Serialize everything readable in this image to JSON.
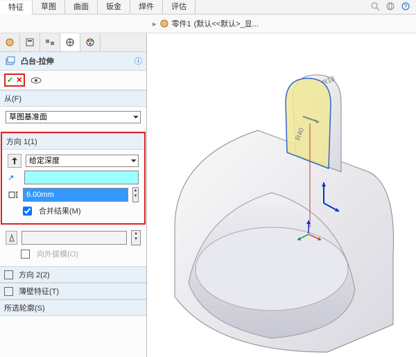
{
  "tabs": [
    "特征",
    "草图",
    "曲面",
    "钣金",
    "焊件",
    "评估"
  ],
  "breadcrumb": {
    "part": "零件1",
    "trail": "(默认<<默认>_显..."
  },
  "feature": {
    "title": "凸台-拉伸"
  },
  "from": {
    "header": "从(F)",
    "value": "草图基准面"
  },
  "dir1": {
    "header": "方向 1(1)",
    "method": "给定深度",
    "distance": "6.00mm",
    "merge": "合并结果(M)"
  },
  "draft": {
    "label": "向外拔模(O)"
  },
  "dir2": {
    "header": "方向 2(2)"
  },
  "thin": {
    "header": "薄壁特征(T)"
  },
  "contour": {
    "header": "所选轮廓(S)"
  }
}
